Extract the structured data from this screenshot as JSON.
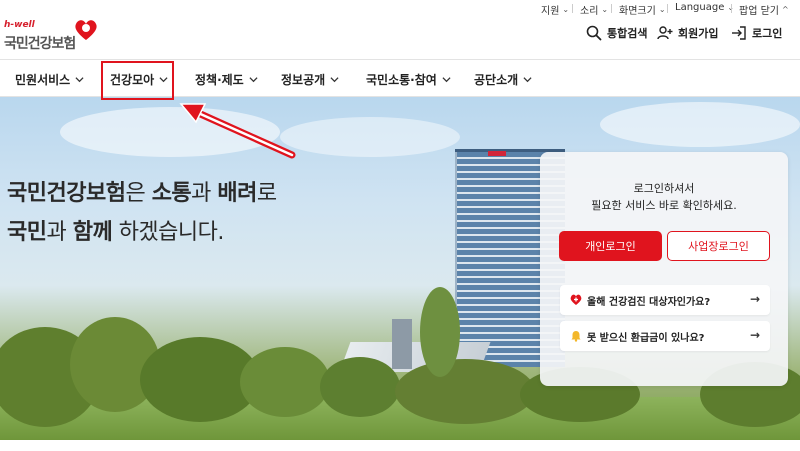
{
  "utility": {
    "support": "지원",
    "sound": "소리",
    "zoom": "화면크기",
    "language": "Language",
    "close_popup": "팝업 닫기"
  },
  "logo": {
    "sub": "h-well",
    "main": "국민건강보험"
  },
  "header": {
    "search": "통합검색",
    "signup": "회원가입",
    "login": "로그인"
  },
  "gnb": {
    "items": [
      "민원서비스",
      "건강모아",
      "정책·제도",
      "정보공개",
      "국민소통·참여",
      "공단소개"
    ]
  },
  "hero": {
    "line1": {
      "p1": "국민건강보험",
      "p2": "은 ",
      "p3": "소통",
      "p4": "과 ",
      "p5": "배려",
      "p6": "로"
    },
    "line2": {
      "p1": "국민",
      "p2": "과 ",
      "p3": "함께",
      "p4": " 하겠습니다."
    }
  },
  "login_card": {
    "title1": "로그인하셔서",
    "title2": "필요한 서비스 바로 확인하세요.",
    "personal_login": "개인로그인",
    "business_login": "사업장로그인",
    "link1": "올해 건강검진 대상자인가요?",
    "link2": "못 받으신 환급금이 있나요?",
    "arrow": "→"
  },
  "colors": {
    "brand_red": "#e0141e",
    "text": "#222222"
  }
}
